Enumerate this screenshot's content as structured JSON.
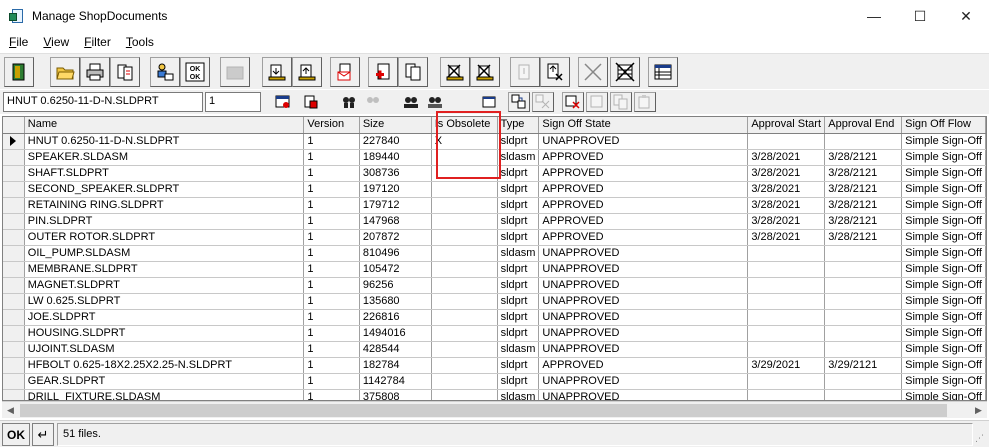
{
  "window": {
    "title": "Manage ShopDocuments",
    "minimize": "—",
    "maximize": "☐",
    "close": "✕"
  },
  "menu": [
    {
      "label": "File",
      "accel": "F",
      "rest": "ile"
    },
    {
      "label": "View",
      "accel": "V",
      "rest": "iew"
    },
    {
      "label": "Filter",
      "accel": "F",
      "rest": "ilter"
    },
    {
      "label": "Tools",
      "accel": "T",
      "rest": "ools"
    }
  ],
  "toolbar2": {
    "name_value": "HNUT 0.6250-11-D-N.SLDPRT",
    "version_value": "1"
  },
  "grid": {
    "columns": [
      "Name",
      "Version",
      "Size",
      "Is Obsolete",
      "Type",
      "Sign Off State",
      "Approval Start",
      "Approval End",
      "Sign Off Flow"
    ],
    "rows": [
      [
        "HNUT 0.6250-11-D-N.SLDPRT",
        "1",
        "227840",
        "X",
        "sldprt",
        "UNAPPROVED",
        "",
        "",
        "Simple Sign-Off"
      ],
      [
        "SPEAKER.SLDASM",
        "1",
        "189440",
        "",
        "sldasm",
        "APPROVED",
        "3/28/2021",
        "3/28/2121",
        "Simple Sign-Off"
      ],
      [
        "SHAFT.SLDPRT",
        "1",
        "308736",
        "",
        "sldprt",
        "APPROVED",
        "3/28/2021",
        "3/28/2121",
        "Simple Sign-Off"
      ],
      [
        "SECOND_SPEAKER.SLDPRT",
        "1",
        "197120",
        "",
        "sldprt",
        "APPROVED",
        "3/28/2021",
        "3/28/2121",
        "Simple Sign-Off"
      ],
      [
        "RETAINING RING.SLDPRT",
        "1",
        "179712",
        "",
        "sldprt",
        "APPROVED",
        "3/28/2021",
        "3/28/2121",
        "Simple Sign-Off"
      ],
      [
        "PIN.SLDPRT",
        "1",
        "147968",
        "",
        "sldprt",
        "APPROVED",
        "3/28/2021",
        "3/28/2121",
        "Simple Sign-Off"
      ],
      [
        "OUTER ROTOR.SLDPRT",
        "1",
        "207872",
        "",
        "sldprt",
        "APPROVED",
        "3/28/2021",
        "3/28/2121",
        "Simple Sign-Off"
      ],
      [
        "OIL_PUMP.SLDASM",
        "1",
        "810496",
        "",
        "sldasm",
        "UNAPPROVED",
        "",
        "",
        "Simple Sign-Off"
      ],
      [
        "MEMBRANE.SLDPRT",
        "1",
        "105472",
        "",
        "sldprt",
        "UNAPPROVED",
        "",
        "",
        "Simple Sign-Off"
      ],
      [
        "MAGNET.SLDPRT",
        "1",
        "96256",
        "",
        "sldprt",
        "UNAPPROVED",
        "",
        "",
        "Simple Sign-Off"
      ],
      [
        "LW 0.625.SLDPRT",
        "1",
        "135680",
        "",
        "sldprt",
        "UNAPPROVED",
        "",
        "",
        "Simple Sign-Off"
      ],
      [
        "JOE.SLDPRT",
        "1",
        "226816",
        "",
        "sldprt",
        "UNAPPROVED",
        "",
        "",
        "Simple Sign-Off"
      ],
      [
        "HOUSING.SLDPRT",
        "1",
        "1494016",
        "",
        "sldprt",
        "UNAPPROVED",
        "",
        "",
        "Simple Sign-Off"
      ],
      [
        "UJOINT.SLDASM",
        "1",
        "428544",
        "",
        "sldasm",
        "UNAPPROVED",
        "",
        "",
        "Simple Sign-Off"
      ],
      [
        "HFBOLT 0.625-18X2.25X2.25-N.SLDPRT",
        "1",
        "182784",
        "",
        "sldprt",
        "APPROVED",
        "3/29/2021",
        "3/29/2121",
        "Simple Sign-Off"
      ],
      [
        "GEAR.SLDPRT",
        "1",
        "1142784",
        "",
        "sldprt",
        "UNAPPROVED",
        "",
        "",
        "Simple Sign-Off"
      ],
      [
        "DRILL_FIXTURE.SLDASM",
        "1",
        "375808",
        "",
        "sldasm",
        "UNAPPROVED",
        "",
        "",
        "Simple Sign-Off"
      ]
    ]
  },
  "status": {
    "ok_label": "OK",
    "return_glyph": "↵",
    "text": "51 files."
  },
  "colors": {
    "highlight": "#e02020",
    "chrome": "#f0f0f0"
  }
}
